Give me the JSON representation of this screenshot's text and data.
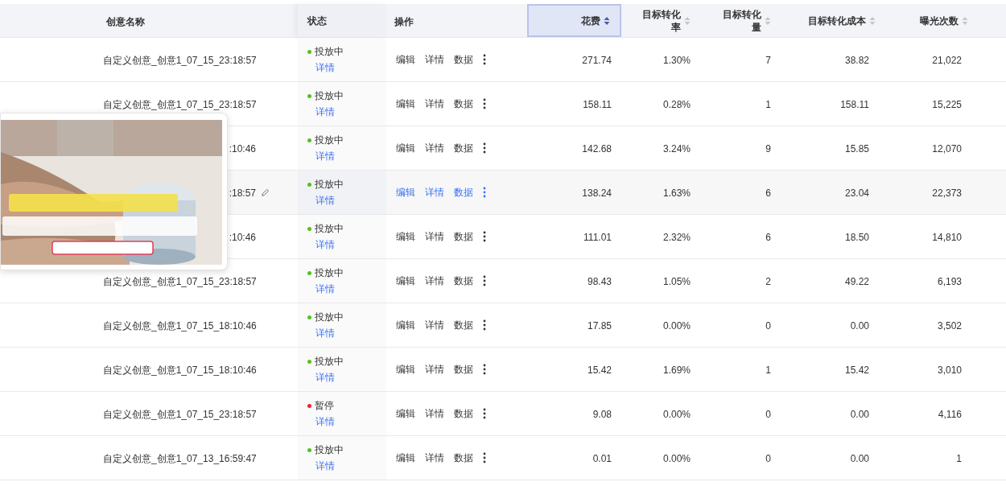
{
  "table": {
    "columns": [
      {
        "label": "创意名称",
        "kind": "text"
      },
      {
        "label": "状态",
        "kind": "text"
      },
      {
        "label": "操作",
        "kind": "text"
      },
      {
        "label": "花费",
        "kind": "sortable",
        "sorted": true
      },
      {
        "label": "目标转化率",
        "kind": "sortable",
        "sorted": false
      },
      {
        "label": "目标转化量",
        "kind": "sortable",
        "sorted": false
      },
      {
        "label": "目标转化成本",
        "kind": "sortable",
        "sorted": false
      },
      {
        "label": "曝光次数",
        "kind": "sortable",
        "sorted": false
      }
    ],
    "rows": [
      {
        "name": "自定义创意_创意1_07_15_23:18:57",
        "status": "投放中",
        "color": "#52c41a",
        "status_link": "详情",
        "actions": [
          "编辑",
          "详情",
          "数据"
        ],
        "hovered": false,
        "values": [
          "271.74",
          "1.30%",
          "7",
          "38.82",
          "21,022"
        ]
      },
      {
        "name": "自定义创意_创意1_07_15_23:18:57",
        "status": "投放中",
        "color": "#52c41a",
        "status_link": "详情",
        "actions": [
          "编辑",
          "详情",
          "数据"
        ],
        "hovered": false,
        "values": [
          "158.11",
          "0.28%",
          "1",
          "158.11",
          "15,225"
        ]
      },
      {
        "name": ":10:46",
        "status": "投放中",
        "color": "#52c41a",
        "status_link": "详情",
        "actions": [
          "编辑",
          "详情",
          "数据"
        ],
        "hovered": false,
        "values": [
          "142.68",
          "3.24%",
          "9",
          "15.85",
          "12,070"
        ]
      },
      {
        "name": ":18:57",
        "status": "投放中",
        "color": "#52c41a",
        "status_link": "详情",
        "actions": [
          "编辑",
          "详情",
          "数据"
        ],
        "hovered": true,
        "values": [
          "138.24",
          "1.63%",
          "6",
          "23.04",
          "22,373"
        ]
      },
      {
        "name": ":10:46",
        "status": "投放中",
        "color": "#52c41a",
        "status_link": "详情",
        "actions": [
          "编辑",
          "详情",
          "数据"
        ],
        "hovered": false,
        "values": [
          "111.01",
          "2.32%",
          "6",
          "18.50",
          "14,810"
        ]
      },
      {
        "name": "自定义创意_创意1_07_15_23:18:57",
        "status": "投放中",
        "color": "#52c41a",
        "status_link": "详情",
        "actions": [
          "编辑",
          "详情",
          "数据"
        ],
        "hovered": false,
        "values": [
          "98.43",
          "1.05%",
          "2",
          "49.22",
          "6,193"
        ]
      },
      {
        "name": "自定义创意_创意1_07_15_18:10:46",
        "status": "投放中",
        "color": "#52c41a",
        "status_link": "详情",
        "actions": [
          "编辑",
          "详情",
          "数据"
        ],
        "hovered": false,
        "values": [
          "17.85",
          "0.00%",
          "0",
          "0.00",
          "3,502"
        ]
      },
      {
        "name": "自定义创意_创意1_07_15_18:10:46",
        "status": "投放中",
        "color": "#52c41a",
        "status_link": "详情",
        "actions": [
          "编辑",
          "详情",
          "数据"
        ],
        "hovered": false,
        "values": [
          "15.42",
          "1.69%",
          "1",
          "15.42",
          "3,010"
        ]
      },
      {
        "name": "自定义创意_创意1_07_15_23:18:57",
        "status": "暂停",
        "color": "#f5222d",
        "status_link": "详情",
        "actions": [
          "编辑",
          "详情",
          "数据"
        ],
        "hovered": false,
        "values": [
          "9.08",
          "0.00%",
          "0",
          "0.00",
          "4,116"
        ]
      },
      {
        "name": "自定义创意_创意1_07_13_16:59:47",
        "status": "投放中",
        "color": "#52c41a",
        "status_link": "详情",
        "actions": [
          "编辑",
          "详情",
          "数据"
        ],
        "hovered": false,
        "values": [
          "0.01",
          "0.00%",
          "0",
          "0.00",
          "1"
        ]
      }
    ]
  }
}
